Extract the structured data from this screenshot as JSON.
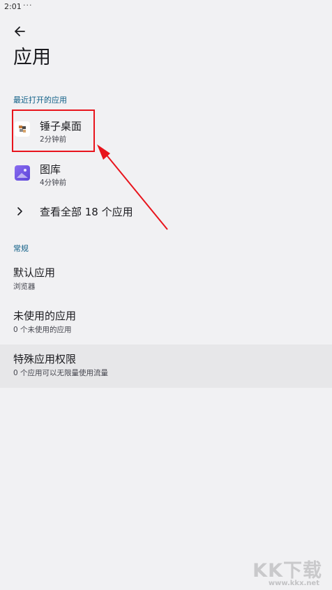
{
  "status_bar": {
    "time": "2:01",
    "dots": "···"
  },
  "header": {
    "back_icon": "arrow-back-icon",
    "title": "应用"
  },
  "recent": {
    "header": "最近打开的应用",
    "items": [
      {
        "name": "锤子桌面",
        "time": "2分钟前",
        "icon": "smartisan-launcher-icon"
      },
      {
        "name": "图库",
        "time": "4分钟前",
        "icon": "gallery-icon"
      }
    ],
    "see_all": {
      "label": "查看全部 18 个应用",
      "icon": "chevron-right-icon"
    }
  },
  "general": {
    "header": "常规",
    "items": [
      {
        "title": "默认应用",
        "subtitle": "浏览器"
      },
      {
        "title": "未使用的应用",
        "subtitle": "0 个未使用的应用"
      },
      {
        "title": "特殊应用权限",
        "subtitle": "0 个应用可以无限量使用流量"
      }
    ]
  },
  "annotation": {
    "highlight_color": "#e8141c"
  },
  "watermark": {
    "logo": "KK下载",
    "url": "www.kkx.net"
  },
  "colors": {
    "background": "#f1f1f3",
    "accent": "#0e5e86",
    "pressed": "#e7e7e9"
  }
}
